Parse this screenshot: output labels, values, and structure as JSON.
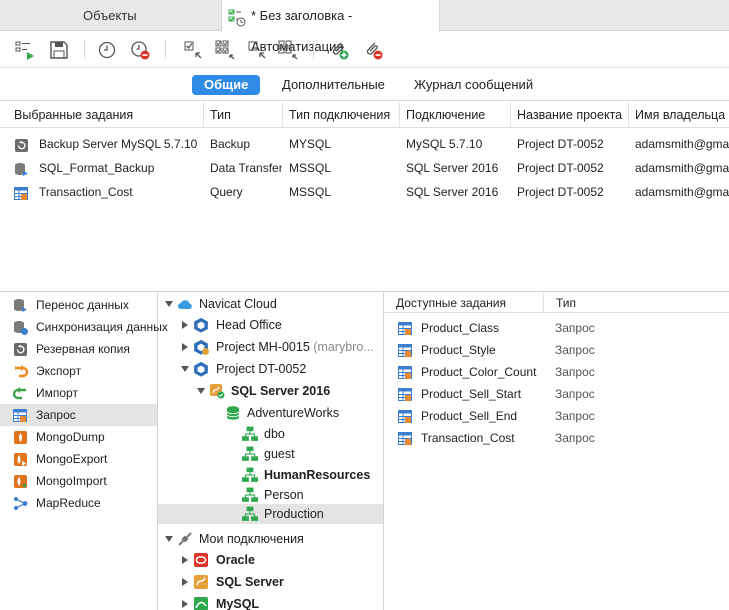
{
  "tabs": {
    "inactive_label": "Объекты",
    "active_label": "* Без заголовка - Автоматизация"
  },
  "toolbar": {
    "buttons": [
      "run-icon",
      "save-icon",
      "schedule-icon",
      "delete-schedule-icon",
      "select-all-icon",
      "deselect-icon",
      "select-icon",
      "select-none-icon",
      "attach-add-icon",
      "attach-remove-icon"
    ]
  },
  "segments": {
    "general": "Общие",
    "advanced": "Дополнительные",
    "log": "Журнал сообщений"
  },
  "grid": {
    "columns": [
      "Выбранные задания",
      "Тип",
      "Тип подключения",
      "Подключение",
      "Название проекта",
      "Имя владельца п"
    ],
    "rows": [
      {
        "name": "Backup Server MySQL 5.7.10",
        "type": "Backup",
        "conn_type": "MYSQL",
        "connection": "MySQL 5.7.10",
        "project": "Project DT-0052",
        "owner": "adamsmith@gma",
        "icon": "backup-icon"
      },
      {
        "name": "SQL_Format_Backup",
        "type": "Data Transfer",
        "conn_type": "MSSQL",
        "connection": "SQL Server 2016",
        "project": "Project DT-0052",
        "owner": "adamsmith@gma",
        "icon": "data-transfer-icon"
      },
      {
        "name": "Transaction_Cost",
        "type": "Query",
        "conn_type": "MSSQL",
        "connection": "SQL Server 2016",
        "project": "Project DT-0052",
        "owner": "adamsmith@gma",
        "icon": "query-icon"
      }
    ]
  },
  "categories": [
    {
      "label": "Перенос данных",
      "icon": "data-transfer-icon"
    },
    {
      "label": "Синхронизация данных",
      "icon": "data-sync-icon"
    },
    {
      "label": "Резервная копия",
      "icon": "backup-icon"
    },
    {
      "label": "Экспорт",
      "icon": "export-icon"
    },
    {
      "label": "Импорт",
      "icon": "import-icon"
    },
    {
      "label": "Запрос",
      "icon": "query-icon"
    },
    {
      "label": "MongoDump",
      "icon": "mongodump-icon"
    },
    {
      "label": "MongoExport",
      "icon": "mongoexport-icon"
    },
    {
      "label": "MongoImport",
      "icon": "mongoimport-icon"
    },
    {
      "label": "MapReduce",
      "icon": "mapreduce-icon"
    }
  ],
  "tree": {
    "cloud": "Navicat Cloud",
    "head_office": "Head Office",
    "project_mh": "Project MH-0015",
    "project_mh_owner": "(marybro...",
    "project_dt": "Project DT-0052",
    "sql_server": "SQL Server 2016",
    "database": "AdventureWorks",
    "schemas": [
      "dbo",
      "guest",
      "HumanResources",
      "Person",
      "Production"
    ],
    "my_connections": "Мои подключения",
    "connections": [
      "Oracle",
      "SQL Server",
      "MySQL"
    ]
  },
  "available": {
    "col_name": "Доступные задания",
    "col_type": "Тип",
    "rows": [
      {
        "name": "Product_Class",
        "type": "Запрос"
      },
      {
        "name": "Product_Style",
        "type": "Запрос"
      },
      {
        "name": "Product_Color_Count",
        "type": "Запрос"
      },
      {
        "name": "Product_Sell_Start",
        "type": "Запрос"
      },
      {
        "name": "Product_Sell_End",
        "type": "Запрос"
      },
      {
        "name": "Transaction_Cost",
        "type": "Запрос"
      }
    ]
  },
  "colors": {
    "accent": "#2f8be6",
    "schema_green": "#2fa84f"
  }
}
